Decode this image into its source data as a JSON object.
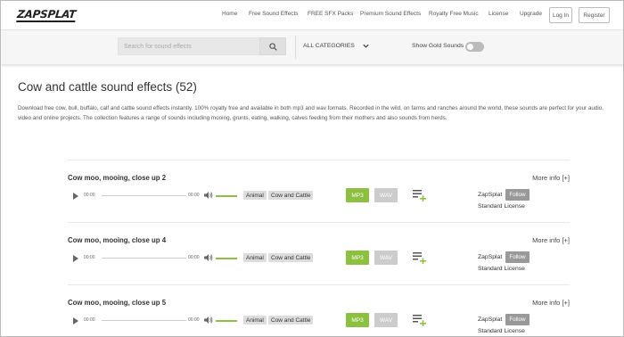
{
  "header": {
    "logo_text": "ZAPSPLAT",
    "nav": [
      "Home",
      "Free Sound Effects",
      "FREE SFX Packs",
      "Premium Sound Effects",
      "Royalty Free Music",
      "License",
      "Upgrade"
    ],
    "login_label": "Log In",
    "register_label": "Register"
  },
  "search": {
    "placeholder": "Search for sound effects",
    "category": "ALL CATEGORIES",
    "gold_label": "Show Gold Sounds",
    "gold_on": false
  },
  "page": {
    "title": "Cow and cattle sound effects (52)",
    "description": "Download free cow, bull, buffalo, calf and cattle sound effects instantly. 100% royalty free and available in both mp3 and wav formats. Recorded in the wild, on farms and ranches around the world, these sounds are perfect for your audio, video and online projects. The collection features a range of sounds including mooing, grunts, eating, walking, calves feeding from their mothers and also sounds from herds."
  },
  "sounds": [
    {
      "title": "Cow moo, mooing, close up 2",
      "more_info": "More info [+]",
      "time_start": "00:00",
      "time_end": "00:00",
      "tags": [
        "Animal",
        "Cow and Cattle"
      ],
      "mp3_label": "MP3",
      "wav_label": "WAV",
      "author": "ZapSplat",
      "follow_label": "Follow",
      "license": "Standard License"
    },
    {
      "title": "Cow moo, mooing, close up 4",
      "more_info": "More info [+]",
      "time_start": "00:00",
      "time_end": "00:00",
      "tags": [
        "Animal",
        "Cow and Cattle"
      ],
      "mp3_label": "MP3",
      "wav_label": "WAV",
      "author": "ZapSplat",
      "follow_label": "Follow",
      "license": "Standard License"
    },
    {
      "title": "Cow moo, mooing, close up 5",
      "more_info": "More info [+]",
      "time_start": "00:00",
      "time_end": "00:00",
      "tags": [
        "Animal",
        "Cow and Cattle"
      ],
      "mp3_label": "MP3",
      "wav_label": "WAV",
      "author": "ZapSplat",
      "follow_label": "Follow",
      "license": "Standard License"
    }
  ],
  "colors": {
    "accent_green": "#8cc13f",
    "wav_grey": "#cccccc",
    "follow_grey": "#999999"
  },
  "icons": {
    "search": "search-icon",
    "chevron": "chevron-down-icon",
    "play": "play-icon",
    "volume": "volume-icon",
    "playlist": "add-to-playlist-icon"
  }
}
